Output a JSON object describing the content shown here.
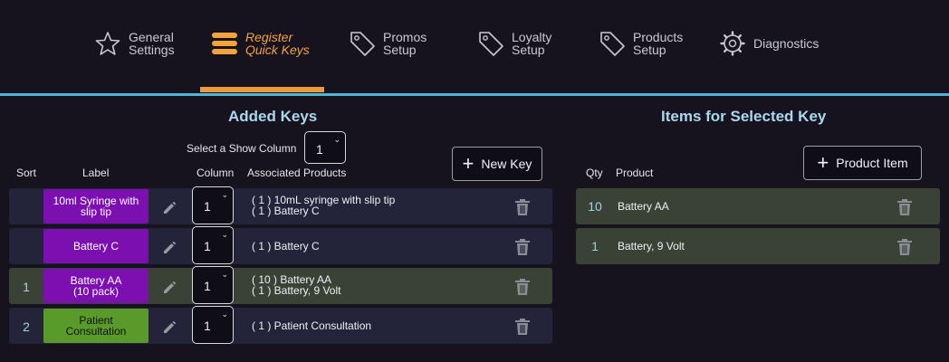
{
  "nav": {
    "items": [
      {
        "label": "General\nSettings",
        "icon": "star-icon",
        "active": false
      },
      {
        "label": "Register\nQuick Keys",
        "icon": "menu-bars-icon",
        "active": true
      },
      {
        "label": "Promos\nSetup",
        "icon": "tag-icon",
        "active": false
      },
      {
        "label": "Loyalty\nSetup",
        "icon": "tag-icon",
        "active": false
      },
      {
        "label": "Products\nSetup",
        "icon": "tag-icon",
        "active": false
      },
      {
        "label": "Diagnostics",
        "icon": "gear-icon",
        "active": false
      }
    ],
    "accent_color": "#ef9a3a",
    "divider_color": "#4fb6d9"
  },
  "added_keys": {
    "title": "Added Keys",
    "show_column_label": "Select a Show Column",
    "show_column_value": "1",
    "new_key_label": "New Key",
    "headers": {
      "sort": "Sort",
      "label": "Label",
      "column": "Column",
      "associated": "Associated Products"
    },
    "rows": [
      {
        "sort": "",
        "label": "10ml Syringe with\nslip tip",
        "chip_color": "#7b0fb0",
        "column": "1",
        "products": "( 1 ) 10mL syringe with slip tip\n( 1 ) Battery C"
      },
      {
        "sort": "",
        "label": "Battery C",
        "chip_color": "#7b0fb0",
        "column": "1",
        "products": "( 1 ) Battery C"
      },
      {
        "sort": "1",
        "label": "Battery AA\n(10 pack)",
        "chip_color": "#7b0fb0",
        "column": "1",
        "products": "( 10 ) Battery AA\n( 1 ) Battery, 9 Volt"
      },
      {
        "sort": "2",
        "label": "Patient\nConsultation",
        "chip_color": "#5a9a2a",
        "column": "1",
        "products": "( 1 ) Patient Consultation"
      }
    ]
  },
  "items_for_key": {
    "title": "Items for Selected Key",
    "product_item_label": "Product Item",
    "headers": {
      "qty": "Qty",
      "product": "Product"
    },
    "rows": [
      {
        "qty": "10",
        "product": "Battery AA"
      },
      {
        "qty": "1",
        "product": "Battery, 9 Volt"
      }
    ]
  }
}
